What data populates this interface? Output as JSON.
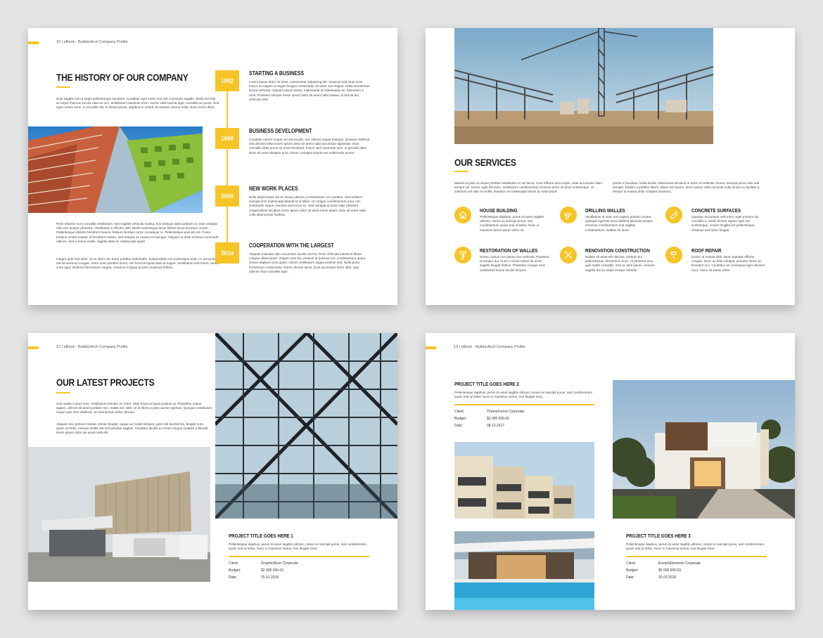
{
  "colors": {
    "accent": "#f7c427",
    "text": "#222222",
    "page": "#ffffff",
    "background": "#e4e4e4"
  },
  "page1": {
    "page_number": "10  |  eBook - BuilderArch Company Profile",
    "title": "THE HISTORY OF OUR COMPANY",
    "intro": "Duis sagittis nisl ut turpis pellentesque hendrerit. Curabitur eget lorem sed nisl commodo sagittis. Morbi vel felis ac turpis rhoncus iaculis vitae ac orci. Vestibulum maximus enim, auctor vitae lacinia eget, convallis ac purus. Sed eget cursus nunc, a convallis nisl. In lectus ipsum, dapibus et urmidl, accumsan viverra nulla. Nunc lorem diam.",
    "body1": "Proin lobortis mi in convallis vestibulum. Sed sagittis vehicula massa, non tristique dolor pretium id. Duis volutpat odio nec tempor pharetra. Vestibulum a efficitur velit. Morbi scelerisque lacus finibus lacus tincidunt ornare. Pellentesque lobortis hendrerit mauris, finibus interdum tortor consequat in. Pellentesque quis est elit. Fusce tempus ornare massa, id hendrerit massa. Sed tempus ac massa vel semper. Aliquam ut dolor at lacus commodo ultrices. Sed a lectus mollis, sagittis diam et, malesuada quam",
    "body2": "Integer quis erat dolor. Ut ac diam nec tortor porttitor sollicitudin. Suspendisse vel scelerisque enim. In accumsan, nisl at euismod congue, tortor enim porttitor lorem, vel rhoncus ligula diam at augue. Vestibulum erat lorem, iaculis a dui eget, eleifend elementum magna. Vivamus in ligula at justo maximus finibus.",
    "timeline": [
      {
        "year": "1992",
        "title": "STARTING A BUSINESS",
        "text": "Lorem ipsum dolor sit amet, consectetur adipiscing elit. Vivamus sed risus enim. Fusce eu sapien ut augue feugiat consectetur sit amet non magna. Nulla elementum luctus vehicula. Aliquam ipsum lorem, malesuada ut malesuada vel, bibendum a urna. Praesent semper lorem ipsum dolor sit amet nulla massa, et lacinia dui vehicula ante."
      },
      {
        "year": "1998",
        "title": "BUSINESS DEVELOPMENT",
        "text": "Curabitur rutrum neque vel nisi iaculis, nec ultrices augue tristique. Quisque eleifend nisl ultricies tellus lorem ipsum dolor sit amet nulla accumsan dignissim. Duis convallis vitae purus sit amet hendrerit. Fusce sed commodo sem, ut gravida diam. Nunc sit amet tristique urna. Donec volutpat mauris nec sollicitudin auctor."
      },
      {
        "year": "2009",
        "title": "NEW WORK PLACES",
        "text": "Nulla ullamcorper dui eu lectus ultrices, in fermentum orci porttitor. Sed at libero suscipit eros malesuada blandit at id tellus. Ut congue condimentum urna, nec sollicitudin neque. Aenean sed luctus ex. Sed volutpat id dolor vitae pharetra. Suspendisse tincidunt lorem ipsum dolor sit amet lorem ipsum dolor sit amet nulla culla ullamcorper facilisis."
      },
      {
        "year": "2014",
        "title": "COOPERATION WITH THE LARGEST",
        "text": "Aliquam molestie odio accumsan iaculis viverra. Proin vehicula massa et libero congue ullamcorper. Integer eros dui, pretium ut pulvinar vel, condimentum quam. Donec dapibus urna quam, rutrum vestibulum augue pretium sed. Nulla porta fermentum consectetur. Donec dictum lacus. Duis accumsan tortor nibh, quis ultrices risus convallis eget."
      }
    ]
  },
  "page2": {
    "title": "OUR SERVICES",
    "intro_left": "Mauris at justo at neque porttitor vestibulum et vel lacus. Cras efficitur arcu turpis, vitae accumsan diam tempor vel. Donec eget elit enim. Vestibulum condimentum rhoncus tortor sit amet scelerisque. Ut interdum vel odio et mollis. Interdum et malesuada fames ac ante ipsum",
    "intro_right": "primis in faucibus. Nulla facilisi. Maecenas tincidunt ut dolor at molestie. Donec suscipit purus odio sed semper. Nullam a porttitor libero. Etiam nisl ipsum, lorem ipsum dolor sit amet nulla luctus eu facilisis a, tempor ut massa dolor volutpat maximus.",
    "services": [
      {
        "icon": "house-icon",
        "title": "HOUSE BUILDING",
        "text": "Pellentesque dapibus, purus sit amet sagittis ultrices, metus ex suscipit purus, sed condimentum quam erat id tellus. Nunc in maximus lorem ipsum dolor sit."
      },
      {
        "icon": "drill-icon",
        "title": "DRILLING WALLES",
        "text": "Vestibulum id nunc non sapien pretium ornare. Quisque egestas urna eleifend placerat tempor. Vivamus condimentum erat sagittis condimentum. Nullam sit amet."
      },
      {
        "icon": "trowel-icon",
        "title": "CONCRETE SURFACES",
        "text": "Quisque accumsan velit enim, eget pretium dui convallis a. Morbi dictum sapien eget est scelerisque, ornare fringilla est pellentesque. Vivamus sed tortor feugiat."
      },
      {
        "icon": "paint-roller-icon",
        "title": "RESTORATION OF WALLES",
        "text": "Donec cursus non ipsum non vehicula. Praesent ut tempor dui. Fusce cursus metus sit amet sagittis feugiat finibus. Phasellus congue eros vestibulum lectus iaculis tempus."
      },
      {
        "icon": "tools-icon",
        "title": "RENOVATION CONSTRUCTION",
        "text": "Nullam sit amet elit ultricies, pretium dui pellentesque, fermentum eros. Ut pharetra arcu quis mollis convallis. Sed ac sem ipsum. Aenean sagittis dui eu turpis semper lobortis."
      },
      {
        "icon": "hammer-icon",
        "title": "ROOF REPAIR",
        "text": "Donec ut massa nibh. Nunc egestas efficitur congue. Nunc ac felis volutpat, posuere lorem ac, tincidunt orci. Curabitur vel consequat eget ultricies nunc. Nunc sit ipsum amet."
      }
    ]
  },
  "page3": {
    "page_number": "12  |  eBook - BuilderArch Company Profile",
    "title": "OUR LATEST PROJECTS",
    "intro1": "Sed mattis cursus eros. Vestibulum semper ex tortor, vitae rhoncus ligula pretium at. Phasellus neque sapien, ultrices sit amet porttitor non, mattis nec nibh. Ut at libero a justo auctor egestas. Quisque vestibulum neque quis eros eleifend, vel elementum dolor ultricies.",
    "intro2": "Aliquam nec pretium massa. Donec feugiat, augue ac mattis tempus, justo nisl laoreet dui, feugiat nunc quam vel felis. Aenean mollis nisl sed pulvinar sagittis. Curabitur iaculis eu tortor congue sodales a blandit lorem ipsum dolor sie amet nulla elit.",
    "project": {
      "title": "PROJECT TITLE GOES HERE 1",
      "text": "Pellentesque dapibus, purus sit amet sagittis ultrices, metus ex suscipit purus, sed condimentum quam erat id tellus. Nunc in maximus metus, non feugiat risus.",
      "client_label": "Client:",
      "client": "GraphicRiver Corporate",
      "budget_label": "Budget:",
      "budget": "$2 000 000.00",
      "date_label": "Date:",
      "date": "15.01.2018"
    }
  },
  "page4": {
    "page_number": "13  |  eBook - BuilderArch Company Profile",
    "project2": {
      "title": "PROJECT TITLE GOES HERE 2",
      "text": "Pellentesque dapibus, purus sit amet sagittis ultrices, metus ex suscipit purus, sed condimentum quam erat id tellus. Nunc in maximus metus, non feugiat risus.",
      "client_label": "Client:",
      "client": "ThemeForest Corporate",
      "budget_label": "Budget:",
      "budget": "$3 000 000.00",
      "date_label": "Date:",
      "date": "08.12.2017"
    },
    "project3": {
      "title": "PROJECT TITLE GOES HERE 3",
      "text": "Pellentesque dapibus, purus sit amet sagittis ultrices, metus ex suscipit purus, sed condimentum quam erat id tellus. Nunc in maximus metus, non feugiat risus.",
      "client_label": "Client:",
      "client": "EnvatoElements Corporate",
      "budget_label": "Budget:",
      "budget": "$5 000 000.00",
      "date_label": "Date:",
      "date": "26.02.2018"
    }
  }
}
